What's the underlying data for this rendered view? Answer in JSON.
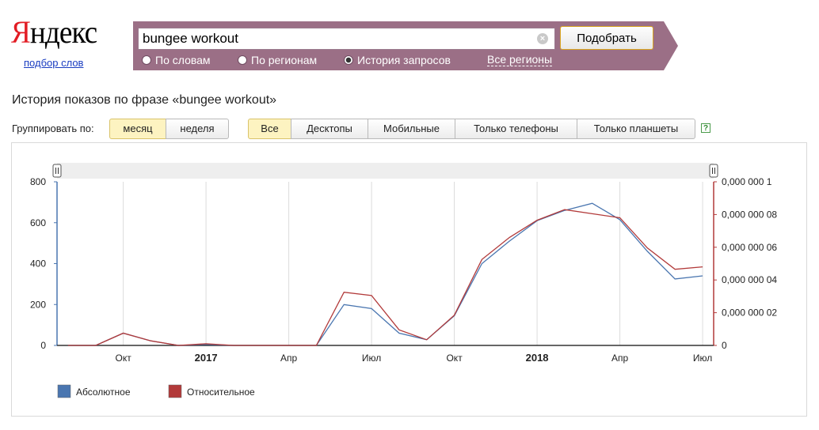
{
  "logo": {
    "first": "Я",
    "rest": "ндекс",
    "subtitle": "подбор слов"
  },
  "search": {
    "value": "bungee workout",
    "placeholder": "",
    "submit_label": "Подобрать"
  },
  "modes": [
    {
      "label": "По словам",
      "selected": false
    },
    {
      "label": "По регионам",
      "selected": false
    },
    {
      "label": "История запросов",
      "selected": true
    }
  ],
  "regions_link": "Все регионы",
  "history_title": "История показов по фразе «bungee workout»",
  "group_label": "Группировать по:",
  "group_options": [
    {
      "label": "месяц",
      "selected": true
    },
    {
      "label": "неделя",
      "selected": false
    }
  ],
  "device_filters": [
    {
      "label": "Все",
      "selected": true
    },
    {
      "label": "Десктопы",
      "selected": false
    },
    {
      "label": "Мобильные",
      "selected": false
    },
    {
      "label": "Только телефоны",
      "selected": false
    },
    {
      "label": "Только планшеты",
      "selected": false
    }
  ],
  "help_label": "?",
  "colors": {
    "band": "#9b6f86",
    "absolute": "#4a76b0",
    "relative": "#b23a3a"
  },
  "chart_data": {
    "type": "line",
    "x": [
      "2016-08",
      "2016-09",
      "2016-10",
      "2016-11",
      "2016-12",
      "2017-01",
      "2017-02",
      "2017-03",
      "2017-04",
      "2017-05",
      "2017-06",
      "2017-07",
      "2017-08",
      "2017-09",
      "2017-10",
      "2017-11",
      "2017-12",
      "2018-01",
      "2018-02",
      "2018-03",
      "2018-04",
      "2018-05",
      "2018-06",
      "2018-07"
    ],
    "x_tick_labels": [
      "Окт",
      "2017",
      "Апр",
      "Июл",
      "Окт",
      "2018",
      "Апр",
      "Июл"
    ],
    "x_tick_positions": [
      "2016-10",
      "2017-01",
      "2017-04",
      "2017-07",
      "2017-10",
      "2018-01",
      "2018-04",
      "2018-07"
    ],
    "bold_ticks": [
      "2017",
      "2018"
    ],
    "y_left_ticks": [
      "0",
      "200",
      "400",
      "600",
      "800"
    ],
    "y_right_ticks": [
      "0",
      "0,000 000 02",
      "0,000 000 04",
      "0,000 000 06",
      "0,000 000 08",
      "0,000 000 1"
    ],
    "ylim_left": [
      0,
      800
    ],
    "ylim_right": [
      0,
      1e-07
    ],
    "series": [
      {
        "name": "Абсолютное",
        "axis": "left",
        "values": [
          0,
          0,
          60,
          22,
          0,
          5,
          0,
          0,
          0,
          0,
          200,
          180,
          60,
          28,
          145,
          400,
          510,
          610,
          660,
          695,
          615,
          460,
          325,
          340
        ]
      },
      {
        "name": "Относительное",
        "axis": "right",
        "values": [
          0,
          0,
          7.5e-09,
          2.8e-09,
          0,
          1e-09,
          0,
          0,
          0,
          0,
          3.25e-08,
          3.05e-08,
          9.5e-09,
          3.5e-09,
          1.85e-08,
          5.25e-08,
          6.6e-08,
          7.65e-08,
          8.3e-08,
          8.05e-08,
          7.8e-08,
          5.95e-08,
          4.65e-08,
          4.8e-08
        ]
      }
    ],
    "grid": true,
    "legend_position": "bottom-left"
  }
}
